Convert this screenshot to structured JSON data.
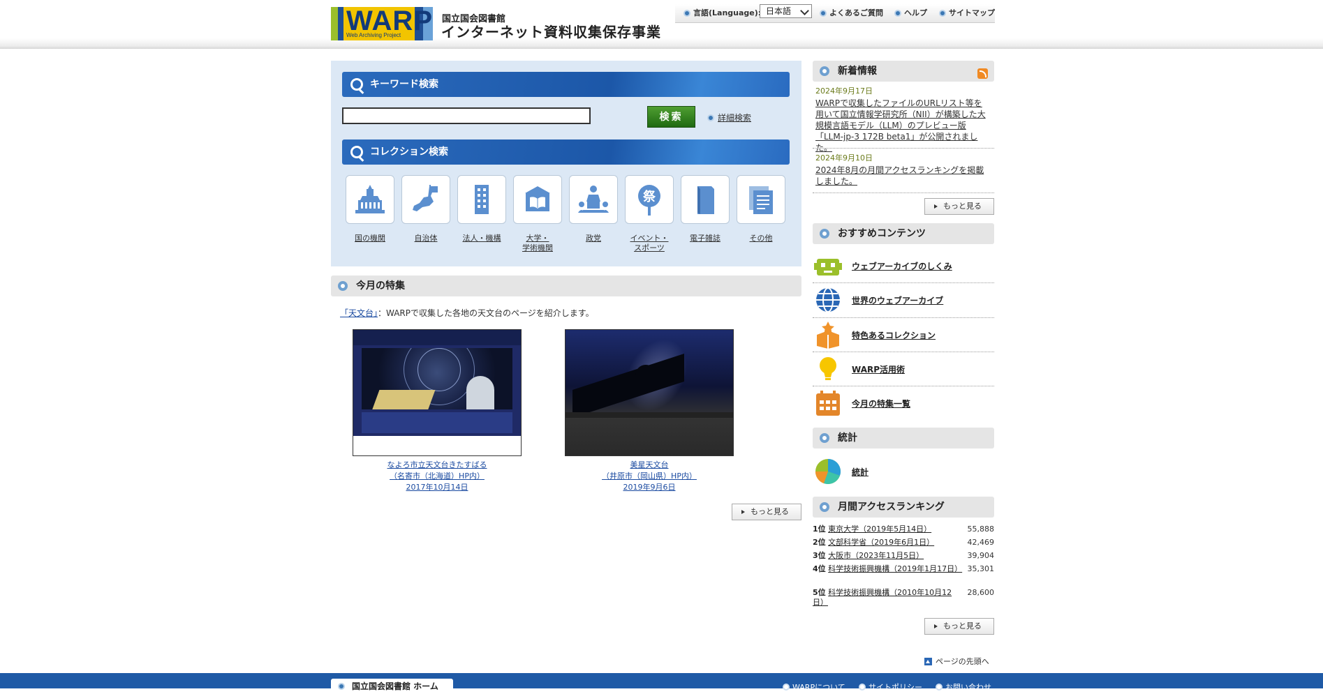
{
  "header": {
    "logo_text": "WARP",
    "logo_sub": "Web Archiving Project",
    "org": "国立国会図書館",
    "site_name": "インターネット資料収集保存事業",
    "language_label": "言語(Language):",
    "language_value": "日本語",
    "faq": "よくあるご質問",
    "help": "ヘルプ",
    "sitemap": "サイトマップ"
  },
  "search": {
    "keyword_heading": "キーワード検索",
    "keyword_value": "",
    "search_button": "検索",
    "advanced_link": "詳細検索",
    "collection_heading": "コレクション検索",
    "collections": [
      {
        "label": "国の機関",
        "icon": "national-diet-building-icon"
      },
      {
        "label": "自治体",
        "icon": "japan-map-flag-icon"
      },
      {
        "label": "法人・機構",
        "icon": "office-building-icon"
      },
      {
        "label": "大学・",
        "label2": "学術機関",
        "icon": "open-book-building-icon"
      },
      {
        "label": "政党",
        "icon": "speaker-podium-icon"
      },
      {
        "label": "イベント・",
        "label2": "スポーツ",
        "icon": "festival-fan-icon"
      },
      {
        "label": "電子雑誌",
        "icon": "magazine-icon"
      },
      {
        "label": "その他",
        "icon": "documents-icon"
      }
    ]
  },
  "feature": {
    "heading": "今月の特集",
    "topic_link": "「天文台」",
    "topic_desc": "：WARPで収集した各地の天文台のページを紹介します。",
    "items": [
      {
        "line1": "なよろ市立天文台きたすばる",
        "line2": "（名寄市（北海道）HP内）",
        "date": "2017年10月14日"
      },
      {
        "line1": "美星天文台",
        "line2": "（井原市（岡山県）HP内）",
        "date": "2019年9月6日"
      }
    ],
    "more": "もっと見る"
  },
  "news": {
    "heading": "新着情報",
    "items": [
      {
        "date": "2024年9月17日",
        "text": "WARPで収集したファイルのURLリスト等を用いて国立情報学研究所（NII）が構築した大規模言語モデル（LLM）のプレビュー版「LLM-jp-3 172B beta1」が公開されました。"
      },
      {
        "date": "2024年9月10日",
        "text": "2024年8月の月間アクセスランキングを掲載しました。"
      }
    ],
    "more": "もっと見る"
  },
  "recommended": {
    "heading": "おすすめコンテンツ",
    "items": [
      {
        "label": "ウェブアーカイブのしくみ",
        "icon": "robot-icon"
      },
      {
        "label": "世界のウェブアーカイブ",
        "icon": "globe-icon"
      },
      {
        "label": "特色あるコレクション",
        "icon": "star-box-icon"
      },
      {
        "label": "WARP活用術",
        "icon": "lightbulb-icon"
      },
      {
        "label": "今月の特集一覧",
        "icon": "calendar-icon"
      }
    ]
  },
  "stats": {
    "heading": "統計",
    "link": "統計",
    "icon": "pie-chart-icon"
  },
  "ranking": {
    "heading": "月間アクセスランキング",
    "rows": [
      {
        "pos": "1位",
        "name": "東京大学（2019年5月14日）",
        "count": "55,888"
      },
      {
        "pos": "2位",
        "name": "文部科学省（2019年6月1日）",
        "count": "42,469"
      },
      {
        "pos": "3位",
        "name": "大阪市（2023年11月5日）",
        "count": "39,904"
      },
      {
        "pos": "4位",
        "name": "科学技術振興機構（2019年1月17日）",
        "count": "35,301"
      },
      {
        "pos": "5位",
        "name": "科学技術振興機構（2010年10月12日）",
        "count": "28,600"
      }
    ],
    "more": "もっと見る"
  },
  "page_top": "ページの先頭へ",
  "footer": {
    "home": "国立国会図書館 ホーム",
    "links": [
      "WARPについて",
      "サイトポリシー",
      "お問い合わせ"
    ]
  }
}
